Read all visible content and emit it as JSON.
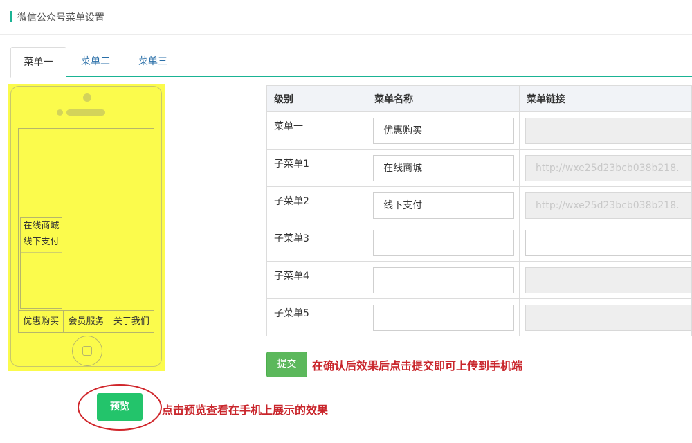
{
  "header": {
    "title": "微信公众号菜单设置"
  },
  "tabs": [
    "菜单一",
    "菜单二",
    "菜单三"
  ],
  "phone": {
    "submenu": [
      "在线商城",
      "线下支付"
    ],
    "menubar": [
      "优惠购买",
      "会员服务",
      "关于我们"
    ]
  },
  "preview": {
    "button": "预览",
    "note": "点击预览查看在手机上展示的效果"
  },
  "table": {
    "headers": [
      "级别",
      "菜单名称",
      "菜单链接"
    ],
    "rows": [
      {
        "level": "菜单一",
        "name": "优惠购买",
        "link": ""
      },
      {
        "level": "子菜单1",
        "name": "在线商城",
        "link": "http://wxe25d23bcb038b218."
      },
      {
        "level": "子菜单2",
        "name": "线下支付",
        "link": "http://wxe25d23bcb038b218."
      },
      {
        "level": "子菜单3",
        "name": "",
        "link": ""
      },
      {
        "level": "子菜单4",
        "name": "",
        "link": ""
      },
      {
        "level": "子菜单5",
        "name": "",
        "link": ""
      }
    ]
  },
  "submit": {
    "button": "提交",
    "note": "在确认后效果后点击提交即可上传到手机端"
  },
  "colors": {
    "accent": "#1ab394",
    "preview_green": "#23c46b",
    "submit_green": "#5cb85c",
    "note_red": "#c9252b",
    "phone_yellow": "#fbfb4c"
  }
}
